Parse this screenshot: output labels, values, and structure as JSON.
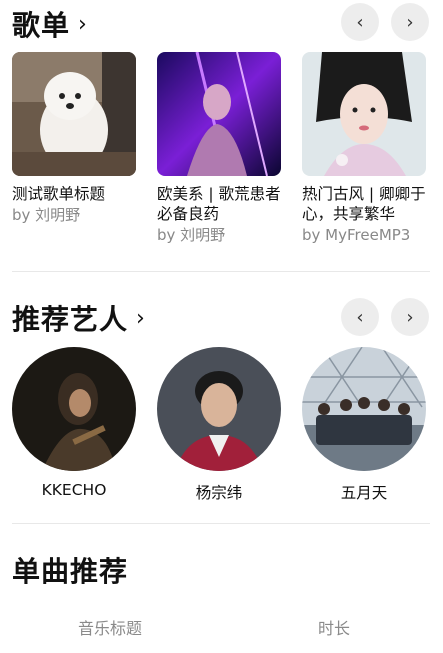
{
  "playlists": {
    "title": "歌单",
    "chevron": "›",
    "prev": "‹",
    "next": "›",
    "items": [
      {
        "title": "测试歌单标题",
        "by": "by 刘明野"
      },
      {
        "title": "欧美系 | 歌荒患者必备良药",
        "by": "by 刘明野"
      },
      {
        "title": "热门古风 | 卿卿于心，共享繁华",
        "by": "by MyFreeMP3"
      }
    ]
  },
  "artists": {
    "title": "推荐艺人",
    "chevron": "›",
    "prev": "‹",
    "next": "›",
    "items": [
      {
        "name": "KKECHO"
      },
      {
        "name": "杨宗纬"
      },
      {
        "name": "五月天"
      }
    ]
  },
  "songs": {
    "title": "单曲推荐",
    "col_title": "音乐标题",
    "col_duration": "时长"
  }
}
